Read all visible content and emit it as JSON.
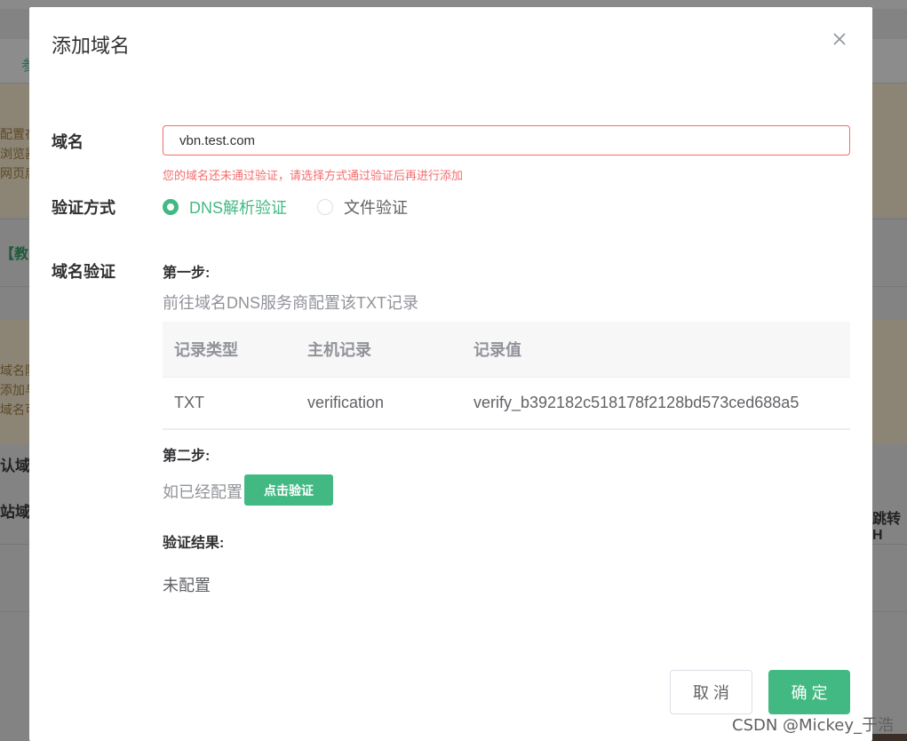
{
  "background": {
    "tab_label": "参",
    "warn_lines_1": [
      "配置在",
      "浏览器",
      "网页后"
    ],
    "link_text": "【教",
    "warn_lines_2": [
      "域名防",
      "添加与",
      "域名可"
    ],
    "bold_1": "认域",
    "bold_2": "站域",
    "right_text": "跳转H"
  },
  "dialog": {
    "title": "添加域名",
    "domain_label": "域名",
    "domain_value": "vbn.test.com",
    "domain_error": "您的域名还未通过验证，请选择方式通过验证后再进行添加",
    "method_label": "验证方式",
    "methods": [
      {
        "label": "DNS解析验证",
        "selected": true
      },
      {
        "label": "文件验证",
        "selected": false
      }
    ],
    "verify_label": "域名验证",
    "step1_title": "第一步:",
    "step1_desc": "前往域名DNS服务商配置该TXT记录",
    "table": {
      "headers": [
        "记录类型",
        "主机记录",
        "记录值"
      ],
      "rows": [
        [
          "TXT",
          "verification",
          "verify_b392182c518178f2128bd573ced688a5"
        ]
      ]
    },
    "step2_title": "第二步:",
    "step2_desc": "如已经配置",
    "verify_button": "点击验证",
    "result_title": "验证结果:",
    "result_value": "未配置",
    "cancel_button": "取 消",
    "confirm_button": "确 定"
  },
  "watermark": "CSDN @Mickey_于浩",
  "colors": {
    "primary": "#42b983",
    "error": "#f56c6c",
    "muted": "#909399"
  }
}
